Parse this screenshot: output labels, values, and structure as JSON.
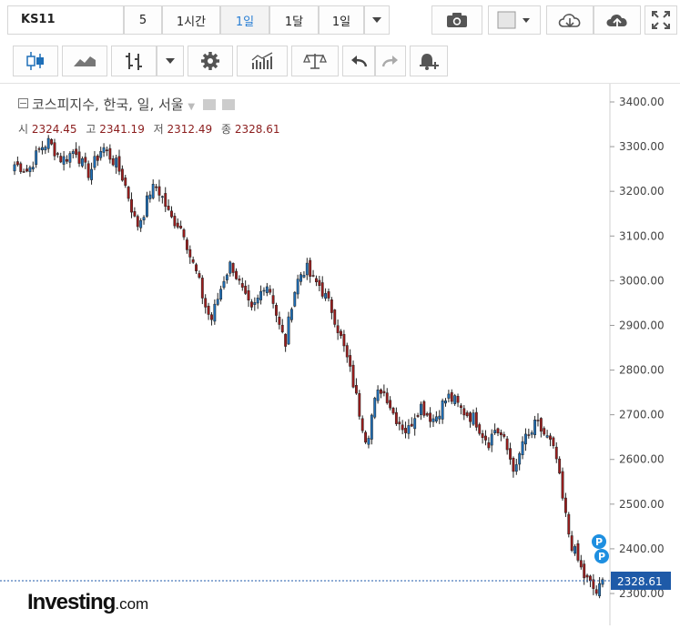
{
  "toolbar": {
    "symbol": "KS11",
    "intervals": [
      "5",
      "1시간",
      "1일",
      "1달",
      "1일"
    ],
    "active_interval": 2
  },
  "legend": {
    "title": "코스피지수, 한국, 일, 서울",
    "open_label": "시",
    "open": "2324.45",
    "high_label": "고",
    "high": "2341.19",
    "low_label": "저",
    "low": "2312.49",
    "close_label": "종",
    "close": "2328.61"
  },
  "brand": {
    "name": "Investing",
    "suffix": ".com"
  },
  "colors": {
    "up": "#1e6fb8",
    "down": "#9c1c1c",
    "grid": "#f0f0f0",
    "last_line": "#1e5aa8"
  },
  "chart_data": {
    "type": "candlestick",
    "title": "코스피지수, 한국, 일, 서울",
    "ylim": [
      2270,
      3430
    ],
    "y_ticks": [
      "2300.00",
      "2400.00",
      "2500.00",
      "2600.00",
      "2700.00",
      "2800.00",
      "2900.00",
      "3000.00",
      "3100.00",
      "3200.00",
      "3300.00",
      "3400.00"
    ],
    "last_price": "2328.61",
    "markers": [
      "P",
      "P"
    ],
    "close_path": [
      3260,
      3255,
      3245,
      3275,
      3300,
      3310,
      3290,
      3270,
      3280,
      3295,
      3260,
      3240,
      3270,
      3300,
      3280,
      3260,
      3230,
      3180,
      3120,
      3150,
      3200,
      3210,
      3180,
      3140,
      3130,
      3110,
      3050,
      3010,
      2950,
      2910,
      2960,
      3010,
      3040,
      3000,
      2960,
      2930,
      2960,
      3000,
      2970,
      2900,
      2860,
      2960,
      3010,
      3030,
      3000,
      2990,
      2960,
      2930,
      2880,
      2830,
      2770,
      2700,
      2640,
      2720,
      2760,
      2740,
      2700,
      2680,
      2660,
      2700,
      2720,
      2700,
      2690,
      2720,
      2740,
      2730,
      2710,
      2700,
      2690,
      2660,
      2640,
      2670,
      2650,
      2610,
      2570,
      2640,
      2650,
      2680,
      2660,
      2640,
      2600,
      2500,
      2420,
      2380,
      2340,
      2320,
      2300,
      2330
    ]
  }
}
